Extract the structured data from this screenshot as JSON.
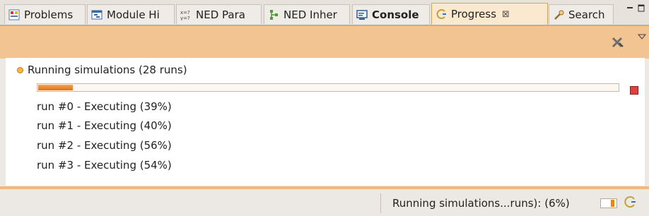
{
  "tabs": [
    {
      "label": "Problems",
      "icon": "problems-icon",
      "active": false
    },
    {
      "label": "Module Hi",
      "icon": "module-hierarchy-icon",
      "active": false
    },
    {
      "label": "NED Para",
      "icon": "ned-parameters-icon",
      "active": false
    },
    {
      "label": "NED Inher",
      "icon": "ned-inheritance-icon",
      "active": false
    },
    {
      "label": "Console",
      "icon": "console-icon",
      "active": false
    },
    {
      "label": "Progress",
      "icon": "progress-icon",
      "active": true,
      "close": "⊠"
    },
    {
      "label": "Search",
      "icon": "search-icon",
      "active": false
    }
  ],
  "colors": {
    "accent": "#f2c491",
    "progress_fill": "#e98324",
    "stop": "#e24040"
  },
  "job": {
    "title": "Running simulations (28 runs)",
    "progress": 0.06
  },
  "runs": [
    {
      "label": "run #0 - Executing (39%)"
    },
    {
      "label": "run #1 - Executing (40%)"
    },
    {
      "label": "run #2 - Executing (56%)"
    },
    {
      "label": "run #3 - Executing (54%)"
    }
  ],
  "status": {
    "text": "Running simulations...runs): (6%)",
    "progress": 0.06
  }
}
